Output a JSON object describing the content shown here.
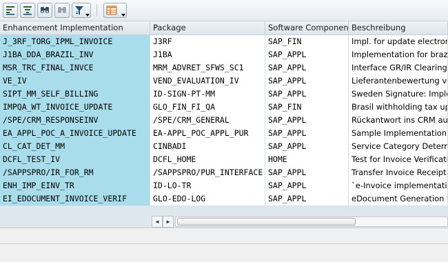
{
  "toolbar": {
    "buttons": [
      {
        "name": "sort-ascending-icon"
      },
      {
        "name": "sort-descending-icon"
      },
      {
        "name": "find-icon"
      },
      {
        "name": "find-next-icon"
      },
      {
        "name": "filter-icon"
      },
      {
        "name": "layout-icon"
      }
    ]
  },
  "table": {
    "columns": [
      "Enhancement Implementation",
      "Package",
      "Software Component",
      "Beschreibung"
    ],
    "rows": [
      [
        "J_3RF_TORG_IPML_INVOICE",
        "J3RF",
        "SAP_FIN",
        "Impl. for update electroni"
      ],
      [
        "J1BA_DDA_BRAZIL_INV",
        "J1BA",
        "SAP_APPL",
        "Implementation for brazil I"
      ],
      [
        "MSR_TRC_FINAL_INVCE",
        "MRM_ADVRET_SFWS_SC1",
        "SAP_APPL",
        "Interface GR/IR Clearing A"
      ],
      [
        "VE_IV",
        "VEND_EVALUATION_IV",
        "SAP_APPL",
        "Lieferantenbewertung vo"
      ],
      [
        "SIPT_MM_SELF_BILLING",
        "ID-SIGN-PT-MM",
        "SAP_APPL",
        "Sweden Signature: Imple"
      ],
      [
        "IMPQA_WT_INVOICE_UPDATE",
        "GLO_FIN_FI_QA",
        "SAP_FIN",
        "Brasil withholding tax upc"
      ],
      [
        "/SPE/CRM_RESPONSEINV",
        "/SPE/CRM_GENERAL",
        "SAP_APPL",
        "Rückantwort ins CRM aus"
      ],
      [
        "EA_APPL_POC_A_INVOICE_UPDATE",
        "EA-APPL_POC_APPL_PUR",
        "SAP_APPL",
        "Sample Implementation fo"
      ],
      [
        "CL_CAT_DET_MM",
        "CINBADI",
        "SAP_APPL",
        "Service Category Determi"
      ],
      [
        "DCFL_TEST_IV",
        "DCFL_HOME",
        "HOME",
        "Test for Invoice Verificati"
      ],
      [
        "/SAPPSPRO/IR_FOR_RM",
        "/SAPPSPRO/PUR_INTERFACE",
        "SAP_APPL",
        "Transfer Invoice Receipt t"
      ],
      [
        "ENH_IMP_EINV_TR",
        "ID-LO-TR",
        "SAP_APPL",
        "`e-Invoice implementation"
      ],
      [
        "EI_EDOCUMENT_INVOICE_VERIF",
        "GLO-EDO-LOG",
        "SAP_APPL",
        "eDocument Generation fo"
      ]
    ]
  },
  "scrollbar": {
    "left_arrow": "◀",
    "right_arrow": "▶",
    "thumb_fraction": 0.66
  }
}
